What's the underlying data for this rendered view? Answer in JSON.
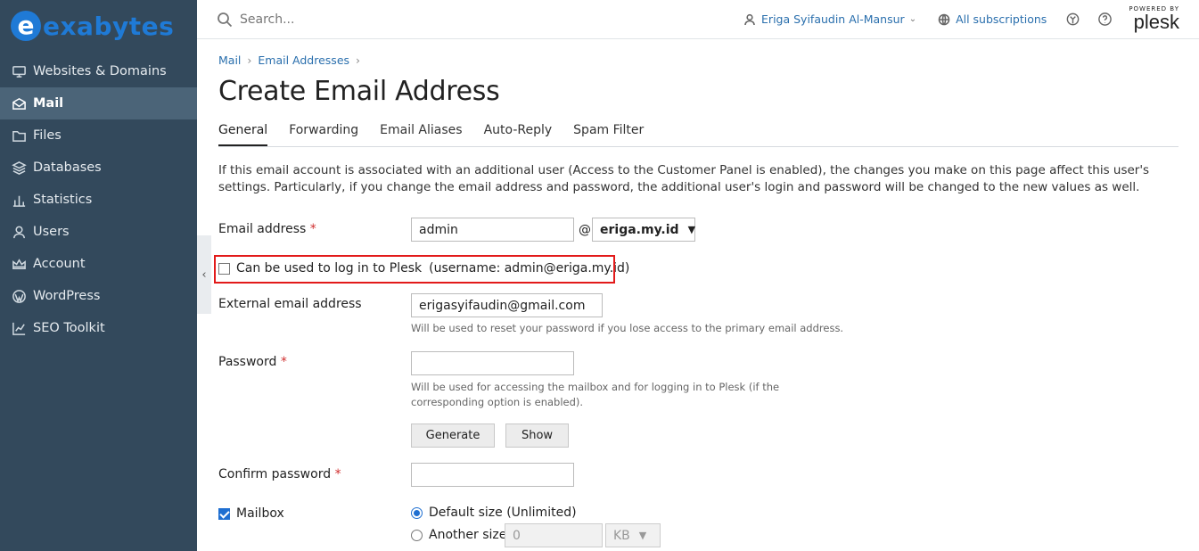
{
  "brand": {
    "logo_letter": "e",
    "logo_text": "exabytes"
  },
  "sidebar": {
    "items": [
      {
        "label": "Websites & Domains",
        "icon": "monitor-icon"
      },
      {
        "label": "Mail",
        "icon": "mail-icon",
        "active": true
      },
      {
        "label": "Files",
        "icon": "folder-icon"
      },
      {
        "label": "Databases",
        "icon": "database-icon"
      },
      {
        "label": "Statistics",
        "icon": "bar-chart-icon"
      },
      {
        "label": "Users",
        "icon": "user-icon"
      },
      {
        "label": "Account",
        "icon": "crown-icon"
      },
      {
        "label": "WordPress",
        "icon": "wordpress-icon"
      },
      {
        "label": "SEO Toolkit",
        "icon": "seo-chart-icon"
      }
    ]
  },
  "topbar": {
    "search_placeholder": "Search...",
    "user_name": "Eriga Syifaudin Al-Mansur",
    "subscriptions": "All subscriptions",
    "powered_by": "POWERED BY",
    "plesk": "plesk"
  },
  "breadcrumb": {
    "items": [
      "Mail",
      "Email Addresses"
    ]
  },
  "page": {
    "title": "Create Email Address"
  },
  "tabs": [
    "General",
    "Forwarding",
    "Email Aliases",
    "Auto-Reply",
    "Spam Filter"
  ],
  "info_text": "If this email account is associated with an additional user (Access to the Customer Panel is enabled), the changes you make on this page affect this user's settings. Particularly, if you change the email address and password, the additional user's login and password will be changed to the new values as well.",
  "form": {
    "email_label": "Email address",
    "required_mark": "*",
    "email_value": "admin",
    "at_sign": "@",
    "domain_value": "eriga.my.id",
    "login_label": "Can be used to log in to Plesk",
    "login_username": "(username: admin@eriga.my.id)",
    "login_checked": false,
    "external_label": "External email address",
    "external_value": "erigasyifaudin@gmail.com",
    "external_hint": "Will be used to reset your password if you lose access to the primary email address.",
    "password_label": "Password",
    "password_value": "",
    "password_hint": "Will be used for accessing the mailbox and for logging in to Plesk (if the corresponding option is enabled).",
    "generate_label": "Generate",
    "show_label": "Show",
    "confirm_label": "Confirm password",
    "confirm_value": "",
    "mailbox_label": "Mailbox",
    "mailbox_checked": true,
    "default_size_label": "Default size (Unlimited)",
    "another_size_label": "Another size",
    "size_value": "0",
    "size_unit": "KB"
  },
  "colors": {
    "sidebar_bg": "#33495c",
    "accent": "#1f7ad6",
    "link": "#2a6fad",
    "highlight": "#e21a1a"
  }
}
